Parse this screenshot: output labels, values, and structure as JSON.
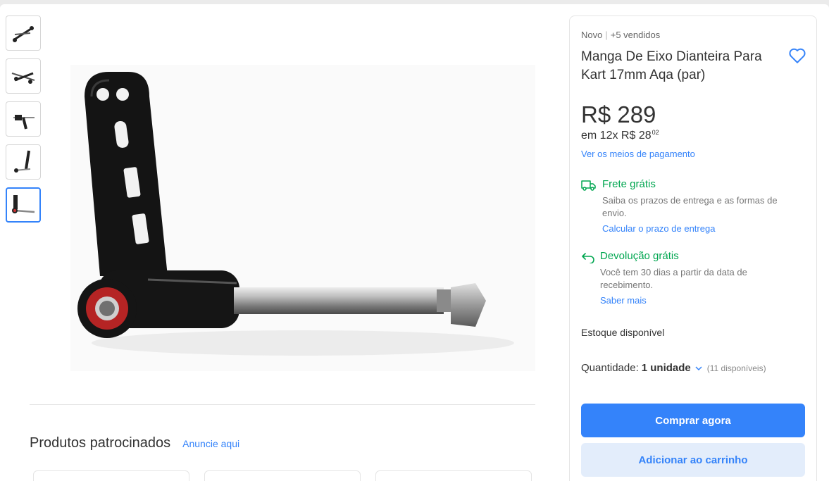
{
  "gallery": {
    "thumbnails": [
      {
        "name": "thumbnail-1",
        "active": false
      },
      {
        "name": "thumbnail-2",
        "active": false
      },
      {
        "name": "thumbnail-3",
        "active": false
      },
      {
        "name": "thumbnail-4",
        "active": false
      },
      {
        "name": "thumbnail-5",
        "active": true
      }
    ],
    "main_image_icon": "kart-spindle-product-photo"
  },
  "product": {
    "condition": "Novo",
    "separator": "|",
    "sold": "+5 vendidos",
    "title": "Manga De Eixo Dianteira Para Kart 17mm Aqa (par)",
    "favorite_icon": "heart-icon",
    "price": "R$ 289",
    "installments_prefix": "em 12x R$ 28",
    "installments_cents": "02",
    "payment_link": "Ver os meios de pagamento"
  },
  "shipping": {
    "icon": "truck-icon",
    "title": "Frete grátis",
    "description": "Saiba os prazos de entrega e as formas de envio.",
    "link": "Calcular o prazo de entrega"
  },
  "returns": {
    "icon": "return-arrow-icon",
    "title": "Devolução grátis",
    "description": "Você tem 30 dias a partir da data de recebimento.",
    "link": "Saber mais"
  },
  "stock": {
    "label": "Estoque disponível"
  },
  "quantity": {
    "label": "Quantidade:",
    "value": "1 unidade",
    "available": "(11 disponíveis)"
  },
  "actions": {
    "buy_now": "Comprar agora",
    "add_to_cart": "Adicionar ao carrinho"
  },
  "sponsored": {
    "title": "Produtos patrocinados",
    "link": "Anuncie aqui"
  },
  "colors": {
    "accent": "#3483fa",
    "success": "#00a650",
    "secondary_bg": "#e3edfb"
  }
}
